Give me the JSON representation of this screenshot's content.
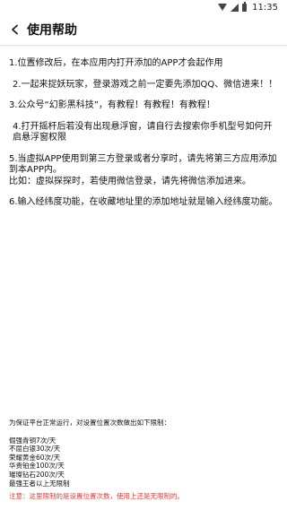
{
  "status_bar": {
    "time": "11:35",
    "icons": [
      "wifi-icon",
      "signal-icon",
      "battery-icon"
    ]
  },
  "app_bar": {
    "back_icon": "chevron-left-icon",
    "title": "使用帮助"
  },
  "help_items": [
    "1.位置修改后，在本应用内打开添加的APP才会起作用",
    "2.一起来捉妖玩家，登录游戏之前一定要先添加QQ、微信进来！！",
    "3.公众号“幻影黑科技”，有教程！有教程！有教程！",
    "4.打开摇杆后若没有出现悬浮窗，请自行去搜索你手机型号如何开启悬浮窗权限",
    "5.当虚拟APP使用到第三方登录或者分享时，请先将第三方应用添加到本APP内。\n比如：虚拟探探时，若使用微信登录，请先将微信添加进来。",
    "6.输入经纬度功能，在收藏地址里的添加地址就是输入经纬度功能。"
  ],
  "limits": {
    "intro": "为保证平台正常运行，对设置位置次数做出如下限制：",
    "rules": [
      "倔强青铜7次/天",
      "不屈白银30次/天",
      "荣耀黄金60次/天",
      "华贵铂金100次/天",
      "璀璨钻石200次/天",
      "最强王者以上无限制"
    ]
  },
  "notice": "注意：这里限制的是设置位置次数，使用上还是无限制的。",
  "colors": {
    "notice": "#e53935",
    "text": "#111111",
    "background": "#ffffff"
  }
}
